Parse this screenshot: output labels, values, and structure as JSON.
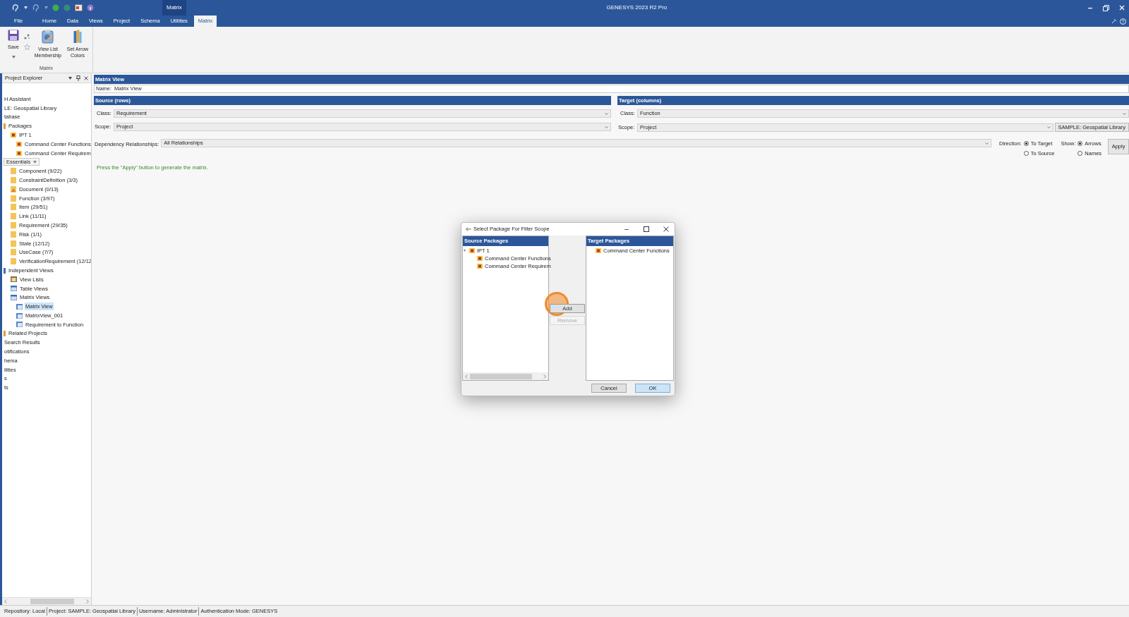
{
  "window": {
    "title": "GENESYS 2023 R2 Pro",
    "context_tab": "Matrix"
  },
  "ribbon": {
    "tabs": [
      {
        "label": "File",
        "selected": false
      },
      {
        "label": "Home",
        "selected": false
      },
      {
        "label": "Data",
        "selected": false
      },
      {
        "label": "Views",
        "selected": false
      },
      {
        "label": "Project",
        "selected": false
      },
      {
        "label": "Schema",
        "selected": false
      },
      {
        "label": "Utilities",
        "selected": false
      },
      {
        "label": "Matrix",
        "selected": true
      }
    ],
    "buttons": [
      {
        "kind": "save",
        "label": "Save"
      },
      {
        "kind": "small-pair"
      },
      {
        "kind": "membership",
        "label": "View List Membership"
      },
      {
        "kind": "arrow-colors",
        "label": "Set Arrow Colors"
      }
    ],
    "group": "Matrix"
  },
  "sidebar": {
    "title": "Project Explorer",
    "items": [
      {
        "label": "H Assistant",
        "kind": "plain",
        "selected": false
      },
      {
        "label": "LE: Geospatial Library",
        "kind": "plain",
        "selected": false
      },
      {
        "label": "tabase",
        "kind": "plain",
        "selected": false
      },
      {
        "label": "Packages",
        "kind": "marker",
        "selected": false,
        "children": [
          {
            "label": "IPT 1",
            "kind": "package",
            "selected": false,
            "children": [
              {
                "label": "Command Center Functions",
                "kind": "package",
                "selected": false
              },
              {
                "label": "Command Center Requirem",
                "kind": "package",
                "selected": false
              }
            ]
          }
        ]
      },
      {
        "label": "Essentials",
        "kind": "dropdown",
        "selected": false,
        "children": [
          {
            "label": "Component  (9/22)",
            "kind": "folder",
            "selected": false
          },
          {
            "label": "ConstraintDefinition  (3/3)",
            "kind": "folder",
            "selected": false
          },
          {
            "label": "Document  (0/13)",
            "kind": "document",
            "selected": false
          },
          {
            "label": "Function  (3/97)",
            "kind": "folder",
            "selected": false
          },
          {
            "label": "Item  (29/51)",
            "kind": "folder",
            "selected": false
          },
          {
            "label": "Link  (11/11)",
            "kind": "folder",
            "selected": false
          },
          {
            "label": "Requirement  (29/35)",
            "kind": "folder",
            "selected": false
          },
          {
            "label": "Risk  (1/1)",
            "kind": "folder",
            "selected": false
          },
          {
            "label": "State  (12/12)",
            "kind": "folder",
            "selected": false
          },
          {
            "label": "UseCase  (7/7)",
            "kind": "folder",
            "selected": false
          },
          {
            "label": "VerificationRequirement  (12/12",
            "kind": "folder",
            "selected": false
          }
        ]
      },
      {
        "label": "Independent Views",
        "kind": "bracket",
        "selected": false,
        "children": [
          {
            "label": "View Lists",
            "kind": "viewlist",
            "selected": false
          },
          {
            "label": "Table Views",
            "kind": "table",
            "selected": false
          },
          {
            "label": "Matrix Views",
            "kind": "table",
            "selected": false,
            "children": [
              {
                "label": "Matrix View",
                "kind": "matrix",
                "selected": true
              },
              {
                "label": "MatrixView_001",
                "kind": "matrix",
                "selected": false
              },
              {
                "label": "Requirement to Function",
                "kind": "matrix",
                "selected": false
              }
            ]
          }
        ]
      },
      {
        "label": "Related Projects",
        "kind": "marker",
        "selected": false
      },
      {
        "label": "Search Results",
        "kind": "plain",
        "selected": false
      },
      {
        "label": "otifications",
        "kind": "plain",
        "selected": false
      },
      {
        "label": "hema",
        "kind": "plain",
        "selected": false
      },
      {
        "label": "ilities",
        "kind": "plain",
        "selected": false
      },
      {
        "label": "s",
        "kind": "plain",
        "selected": false
      },
      {
        "label": "ts",
        "kind": "plain",
        "selected": false
      }
    ]
  },
  "matrix_view": {
    "title": "Matrix View",
    "name_label": "Name:",
    "name": "Matrix View",
    "source": {
      "title": "Source (rows)",
      "class_label": "Class:",
      "class": "Requirement",
      "scope_label": "Scope:",
      "scope": "Project"
    },
    "target": {
      "title": "Target (columns)",
      "class_label": "Class:",
      "class": "Function",
      "scope_label": "Scope:",
      "scope": "Project",
      "scope_button": "SAMPLE: Geospatial Library"
    },
    "dependency_label": "Dependency Relationships:",
    "dependency": "All Relationships",
    "direction": {
      "label": "Direction:",
      "options": [
        {
          "label": "To Target",
          "selected": true
        },
        {
          "label": "To Source",
          "selected": false
        }
      ]
    },
    "show": {
      "label": "Show:",
      "options": [
        {
          "label": "Arrows",
          "selected": true
        },
        {
          "label": "Names",
          "selected": false
        }
      ]
    },
    "apply": "Apply",
    "message": "Press the \"Apply\" button to generate the matrix."
  },
  "dialog": {
    "title": "Select Package For Filter Scope",
    "source_title": "Source Packages",
    "source_tree": [
      {
        "label": "IPT 1",
        "children": [
          {
            "label": "Command Center Functions"
          },
          {
            "label": "Command Center Requirem"
          }
        ]
      }
    ],
    "target_title": "Target Packages",
    "target_items": [
      {
        "label": "Command Center Functions"
      }
    ],
    "buttons": [
      {
        "label": "Add",
        "disabled": false,
        "highlighted": true
      },
      {
        "label": "Remove",
        "disabled": true,
        "highlighted": false
      }
    ],
    "cancel": "Cancel",
    "ok": "OK"
  },
  "status_bar": [
    "Repository: Local",
    "Project: SAMPLE: Geospatial Library",
    "Username: Administrator",
    "Authentication Mode: GENESYS"
  ]
}
